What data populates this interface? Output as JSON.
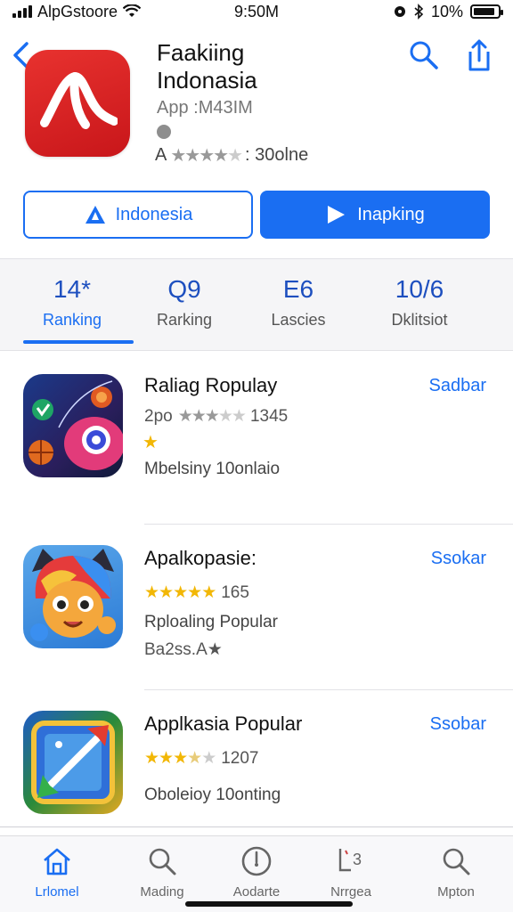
{
  "status_bar": {
    "carrier": "AlpGstoore",
    "time": "9:50M",
    "battery_text": "10%",
    "battery_level": 0.9,
    "icons": [
      "signal-icon",
      "wifi-icon",
      "alarm-icon",
      "bluetooth-icon",
      "battery-icon"
    ]
  },
  "header": {
    "back_icon": "chevron-left-icon",
    "title_line1": "Faakiing",
    "title_line2": "Indonasia",
    "subtitle": "App :M43IM",
    "rating_prefix": "A",
    "rating_suffix": ": 30olne",
    "rating_stars": 4,
    "icons": [
      "search-icon",
      "share-icon"
    ]
  },
  "actions": {
    "outline_label": "Indonesia",
    "outline_icon": "triangle-icon",
    "solid_label": "Inapking",
    "solid_icon": "play-icon"
  },
  "stats": [
    {
      "value": "14*",
      "label": "Ranking",
      "active": true
    },
    {
      "value": "Q9",
      "label": "Rarking",
      "active": false
    },
    {
      "value": "E6",
      "label": "Lascies",
      "active": false
    },
    {
      "value": "10/6",
      "label": "Dklitsiot",
      "active": false
    }
  ],
  "list": [
    {
      "title": "Raliag Ropulay",
      "action": "Sadbar",
      "rating_prefix": "2po",
      "rating_count": "1345",
      "stars": 3,
      "extra_star": true,
      "desc1": "Mbelsiny  10onlaio",
      "desc2": ""
    },
    {
      "title": "Apalkopasie:",
      "action": "Ssokar",
      "rating_prefix": "",
      "rating_count": "165",
      "stars": 5,
      "extra_star": false,
      "desc1": "Rploaling  Popular",
      "desc2": "Ba2ss.A★"
    },
    {
      "title": "Applkasia Popular",
      "action": "Ssobar",
      "rating_prefix": "",
      "rating_count": "1207",
      "stars": 3.5,
      "extra_star": false,
      "desc1": "Oboleioy  10onting",
      "desc2": ""
    }
  ],
  "tabs": [
    {
      "label": "Lrlomel",
      "icon": "home-icon",
      "active": true
    },
    {
      "label": "Mading",
      "icon": "search-icon",
      "active": false
    },
    {
      "label": "Aodarte",
      "icon": "compass-icon",
      "active": false
    },
    {
      "label": "Nrrgea",
      "icon": "rankings-icon",
      "active": false
    },
    {
      "label": "Mpton",
      "icon": "search-icon",
      "active": false
    }
  ],
  "colors": {
    "accent": "#1a6ef2",
    "app_icon_red": "#e8322f",
    "star_gold": "#f2b705"
  }
}
